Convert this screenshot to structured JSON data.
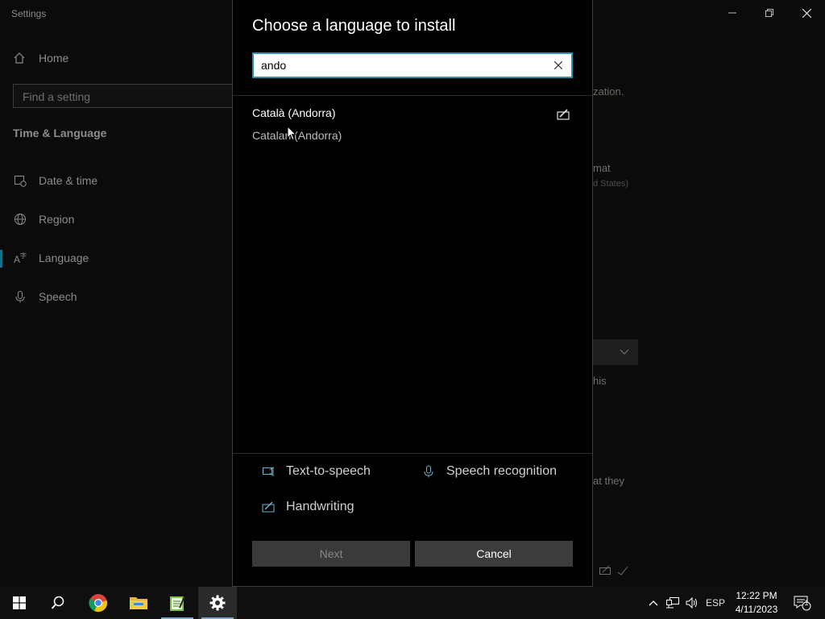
{
  "settings": {
    "window_title": "Settings",
    "home_label": "Home",
    "search_placeholder": "Find a setting",
    "section_title": "Time & Language",
    "nav_items": [
      {
        "label": "Date & time",
        "icon": "calendar-clock-icon"
      },
      {
        "label": "Region",
        "icon": "globe-icon"
      },
      {
        "label": "Language",
        "icon": "language-icon"
      },
      {
        "label": "Speech",
        "icon": "microphone-icon"
      }
    ],
    "background_fragments": {
      "zation": "zation.",
      "mat": "mat",
      "states": "d States)",
      "this": "his",
      "at_they": "at they"
    }
  },
  "dialog": {
    "title": "Choose a language to install",
    "search_value": "ando",
    "results": [
      {
        "native": "Català (Andorra)",
        "english": "Catalan (Andorra)",
        "feature_icon": "handwriting-icon"
      }
    ],
    "features": {
      "tts": "Text-to-speech",
      "speech": "Speech recognition",
      "handwriting": "Handwriting"
    },
    "next_label": "Next",
    "cancel_label": "Cancel"
  },
  "taskbar": {
    "language": "ESP",
    "time": "12:22 PM",
    "date": "4/11/2023",
    "notification_count": "1"
  },
  "colors": {
    "accent": "#2f8fb5",
    "dialog_bg": "#000000",
    "button_bg": "#3c3c3c"
  }
}
